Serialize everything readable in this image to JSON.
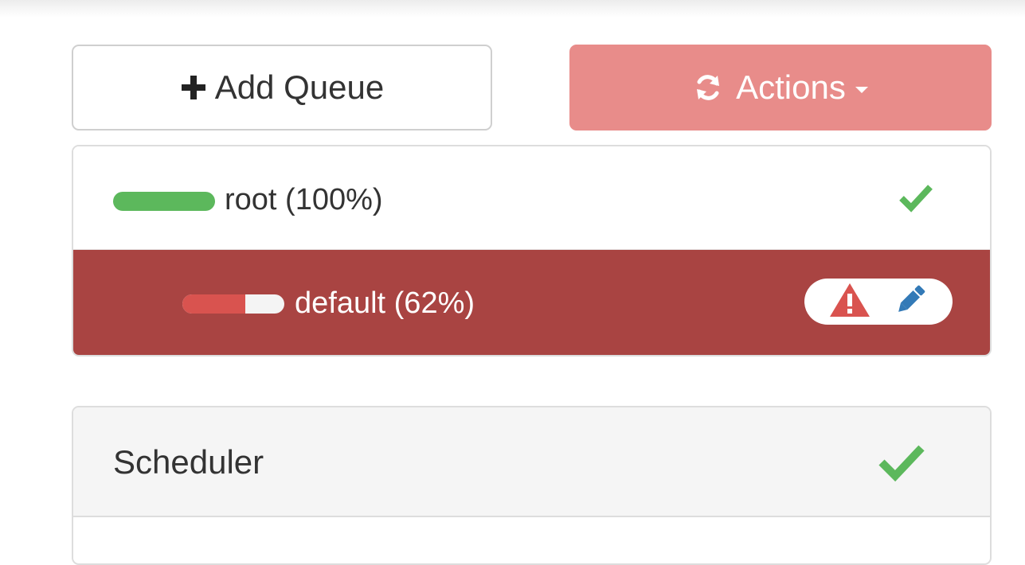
{
  "toolbar": {
    "add_queue_label": "Add Queue",
    "add_queue_icon": "plus-icon",
    "actions_label": "Actions",
    "actions_icon": "refresh-icon"
  },
  "queues": [
    {
      "label": "root (100%)",
      "capacity_fraction": 1.0,
      "status_icon": "check-icon",
      "bar_color": "#5cb85c"
    },
    {
      "label": "default (62%)",
      "capacity_fraction": 0.62,
      "status_icons": [
        "warning-icon",
        "pencil-icon"
      ],
      "bar_color": "#d9534f",
      "row_color": "#a94442"
    }
  ],
  "scheduler": {
    "title": "Scheduler",
    "status_icon": "check-icon"
  },
  "colors": {
    "success": "#5cb85c",
    "danger": "#a94442",
    "danger_light": "#e88c8a",
    "warning_icon": "#d9534f",
    "edit_icon": "#337ab7"
  }
}
